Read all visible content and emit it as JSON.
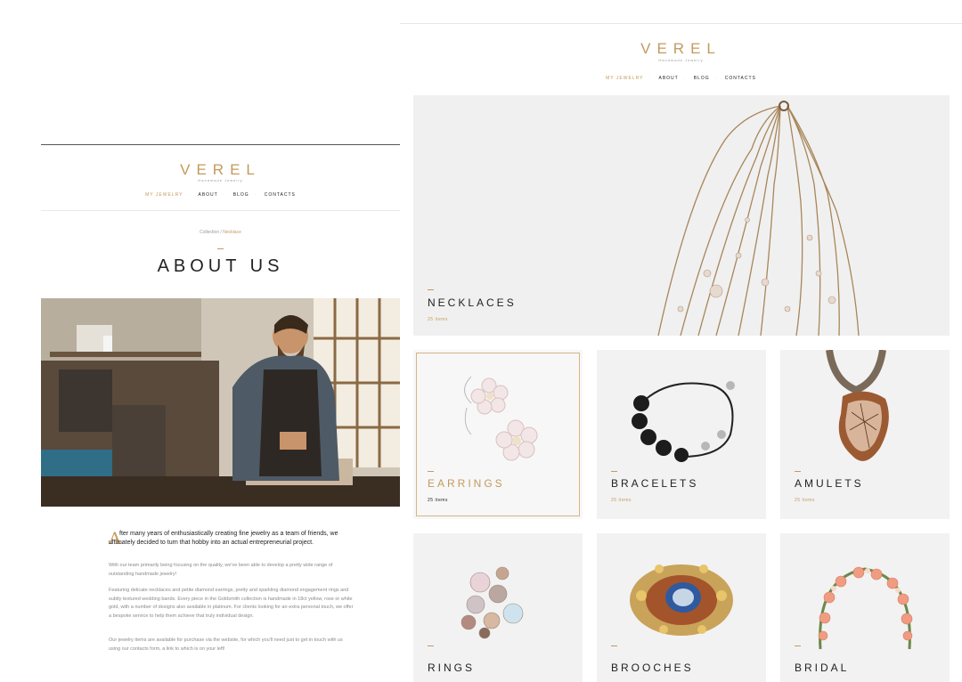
{
  "about_page": {
    "logo": "VEREL",
    "tagline": "Handmade Jewelry",
    "nav": [
      "MY JEWELRY",
      "ABOUT",
      "BLOG",
      "CONTACTS"
    ],
    "breadcrumb": {
      "home": "Collection",
      "separator": "/",
      "current": "Necklace"
    },
    "title": "ABOUT US",
    "dropcap": "A",
    "intro": "fter many years of enthusiastically creating fine jewelry as a team of friends, we ultimately decided to turn that hobby into an actual entrepreneurial project.",
    "paragraphs": [
      "With our team primarily being focusing on the quality, we've been able to develop a pretty wide range of outstanding handmade jewelry!",
      "Featuring delicate necklaces and petite diamond earrings, pretty and sparkling diamond engagement rings and subtly textured wedding bands. Every piece in the Goldsmith collection is handmade in 18ct yellow, rose or white gold, with a number of designs also available in platinum. For clients looking for an extra personal touch, we offer a bespoke service to help them achieve that truly individual design.",
      "Our jewelry items are available for purchase via the website, for which you'll need just to get in touch with us using our contacts form, a link to which is on your left!"
    ]
  },
  "catalog_page": {
    "logo": "VEREL",
    "tagline": "Handmade Jewelry",
    "nav": [
      "MY JEWELRY",
      "ABOUT",
      "BLOG",
      "CONTACTS"
    ],
    "hero": {
      "name": "NECKLACES",
      "count": "25 items"
    },
    "categories": [
      {
        "name": "EARRINGS",
        "count": "25 items"
      },
      {
        "name": "BRACELETS",
        "count": "25 items"
      },
      {
        "name": "AMULETS",
        "count": "25 items"
      },
      {
        "name": "RINGS",
        "count": ""
      },
      {
        "name": "BROOCHES",
        "count": ""
      },
      {
        "name": "BRIDAL",
        "count": ""
      }
    ]
  },
  "colors": {
    "accent": "#c39a5d",
    "text": "#222222",
    "muted": "#8a8a8a",
    "tile_bg": "#f1f1f1"
  }
}
